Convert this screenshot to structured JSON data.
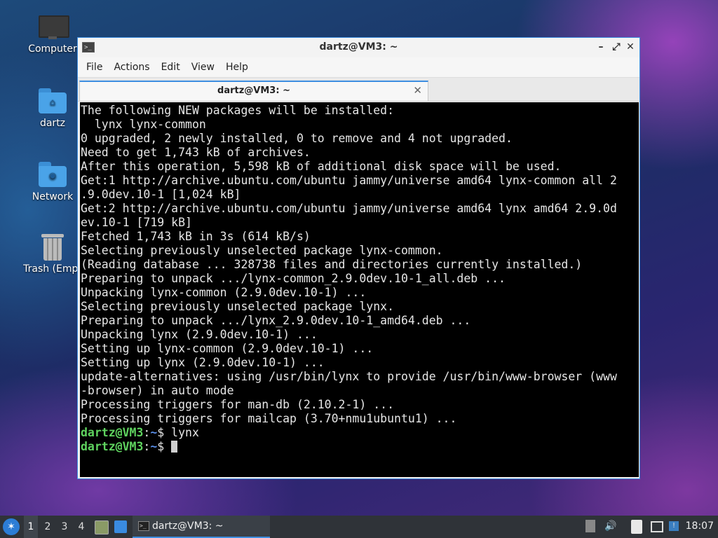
{
  "desktop": {
    "icons": [
      {
        "label": "Computer",
        "icon": "computer-icon"
      },
      {
        "label": "dartz",
        "icon": "home-folder-icon"
      },
      {
        "label": "Network",
        "icon": "network-folder-icon"
      },
      {
        "label": "Trash (Empt",
        "icon": "trash-icon"
      }
    ]
  },
  "window": {
    "title": "dartz@VM3: ~",
    "menu": [
      "File",
      "Actions",
      "Edit",
      "View",
      "Help"
    ],
    "tab": {
      "label": "dartz@VM3: ~"
    },
    "terminal": {
      "lines": [
        "The following NEW packages will be installed:",
        "  lynx lynx-common",
        "0 upgraded, 2 newly installed, 0 to remove and 4 not upgraded.",
        "Need to get 1,743 kB of archives.",
        "After this operation, 5,598 kB of additional disk space will be used.",
        "Get:1 http://archive.ubuntu.com/ubuntu jammy/universe amd64 lynx-common all 2",
        ".9.0dev.10-1 [1,024 kB]",
        "Get:2 http://archive.ubuntu.com/ubuntu jammy/universe amd64 lynx amd64 2.9.0d",
        "ev.10-1 [719 kB]",
        "Fetched 1,743 kB in 3s (614 kB/s)",
        "Selecting previously unselected package lynx-common.",
        "(Reading database ... 328738 files and directories currently installed.)",
        "Preparing to unpack .../lynx-common_2.9.0dev.10-1_all.deb ...",
        "Unpacking lynx-common (2.9.0dev.10-1) ...",
        "Selecting previously unselected package lynx.",
        "Preparing to unpack .../lynx_2.9.0dev.10-1_amd64.deb ...",
        "Unpacking lynx (2.9.0dev.10-1) ...",
        "Setting up lynx-common (2.9.0dev.10-1) ...",
        "Setting up lynx (2.9.0dev.10-1) ...",
        "update-alternatives: using /usr/bin/lynx to provide /usr/bin/www-browser (www",
        "-browser) in auto mode",
        "Processing triggers for man-db (2.10.2-1) ...",
        "Processing triggers for mailcap (3.70+nmu1ubuntu1) ..."
      ],
      "prompt": {
        "user_host": "dartz@VM3",
        "sep": ":",
        "path": "~",
        "symbol": "$"
      },
      "command_history": [
        "lynx"
      ],
      "current_input": ""
    }
  },
  "taskbar": {
    "workspaces": [
      "1",
      "2",
      "3",
      "4"
    ],
    "active_workspace": "1",
    "task_label": "dartz@VM3: ~",
    "clock": "18:07"
  },
  "colors": {
    "accent": "#3d8ee0",
    "prompt_user": "#5fd35f",
    "prompt_path": "#5a8fe8",
    "terminal_bg": "#000000",
    "terminal_fg": "#e6e6e6"
  }
}
